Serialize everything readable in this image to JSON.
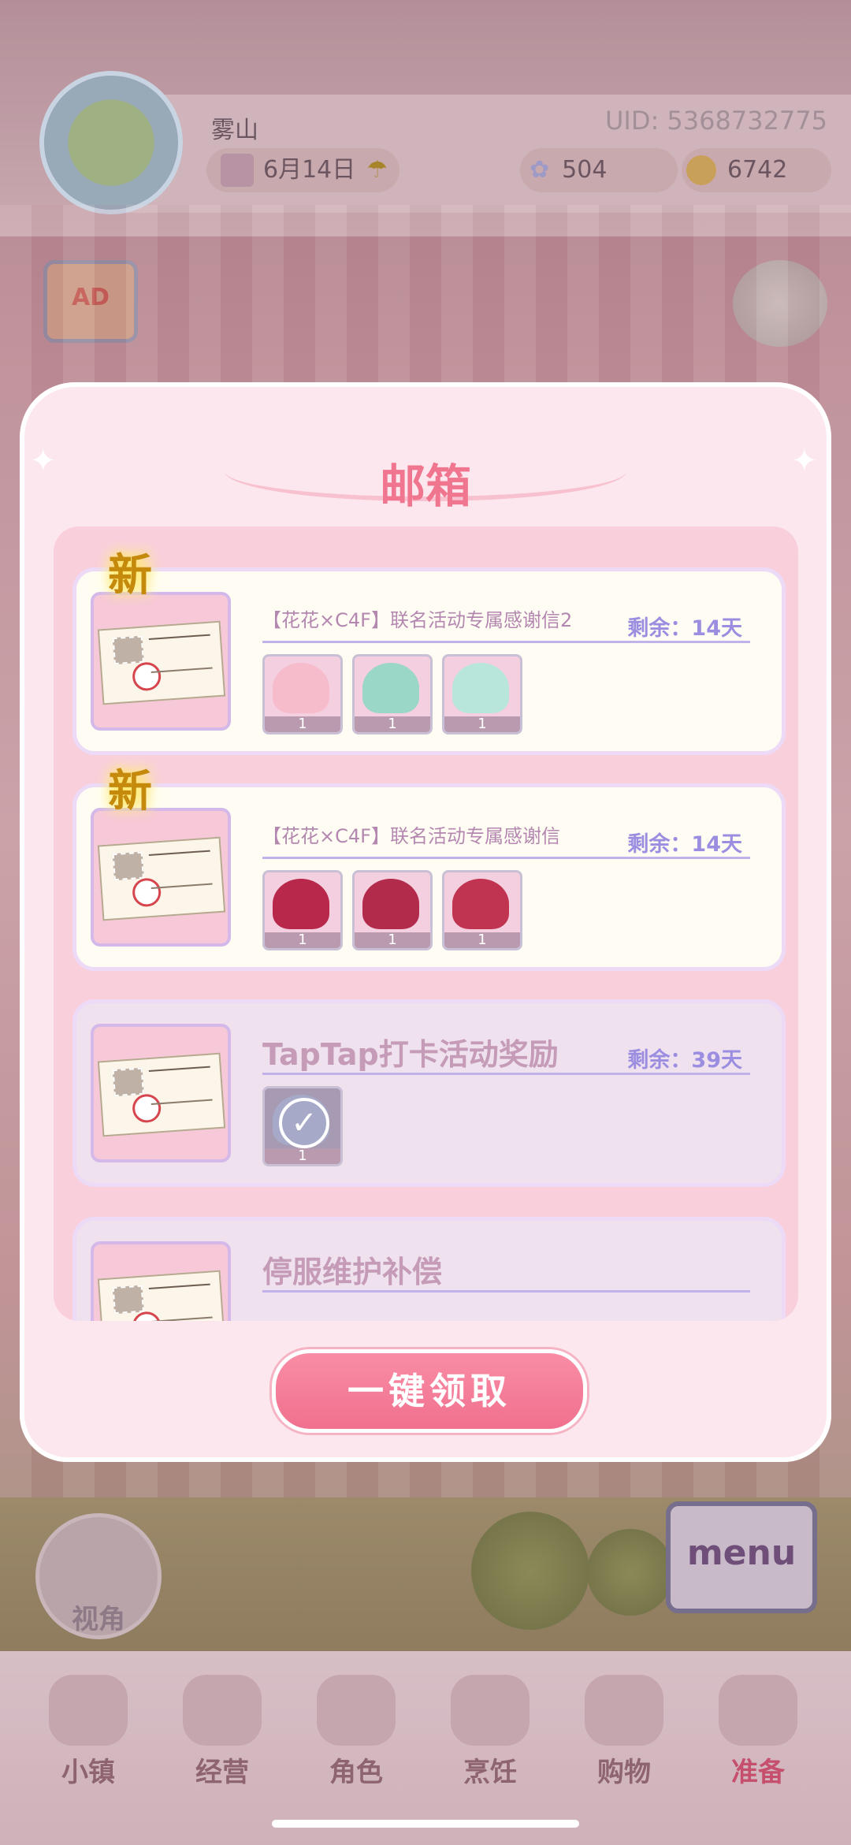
{
  "player": {
    "name": "雾山",
    "uid": "UID: 5368732775",
    "date": "6月14日",
    "gems": "504",
    "coins": "6742"
  },
  "side": {
    "ad_label": "AD"
  },
  "mailbox": {
    "title": "邮箱",
    "claim_all_label": "一键领取",
    "new_badge": "新",
    "mails": [
      {
        "title": "【花花×C4F】联名活动专属感谢信2",
        "remaining": "剩余：14天",
        "is_new": true,
        "items": [
          {
            "qty": "1",
            "color": "#f7bccc"
          },
          {
            "qty": "1",
            "color": "#9ad7c7"
          },
          {
            "qty": "1",
            "color": "#b9e6db"
          }
        ]
      },
      {
        "title": "【花花×C4F】联名活动专属感谢信",
        "remaining": "剩余：14天",
        "is_new": true,
        "items": [
          {
            "qty": "1",
            "color": "#b7284a"
          },
          {
            "qty": "1",
            "color": "#b32b4a"
          },
          {
            "qty": "1",
            "color": "#c03452"
          }
        ]
      },
      {
        "title": "TapTap打卡活动奖励",
        "remaining": "剩余：39天",
        "is_new": false,
        "claimed": true,
        "items": [
          {
            "qty": "1",
            "color": "#a7a9c8"
          }
        ]
      },
      {
        "title": "停服维护补偿",
        "remaining": "",
        "is_new": false,
        "items": []
      }
    ]
  },
  "bottom_nav": [
    {
      "label": "小镇"
    },
    {
      "label": "经营"
    },
    {
      "label": "角色"
    },
    {
      "label": "烹饪"
    },
    {
      "label": "购物"
    },
    {
      "label": "准备",
      "active": true
    }
  ],
  "camera_label": "视角",
  "menu_label": "menu"
}
